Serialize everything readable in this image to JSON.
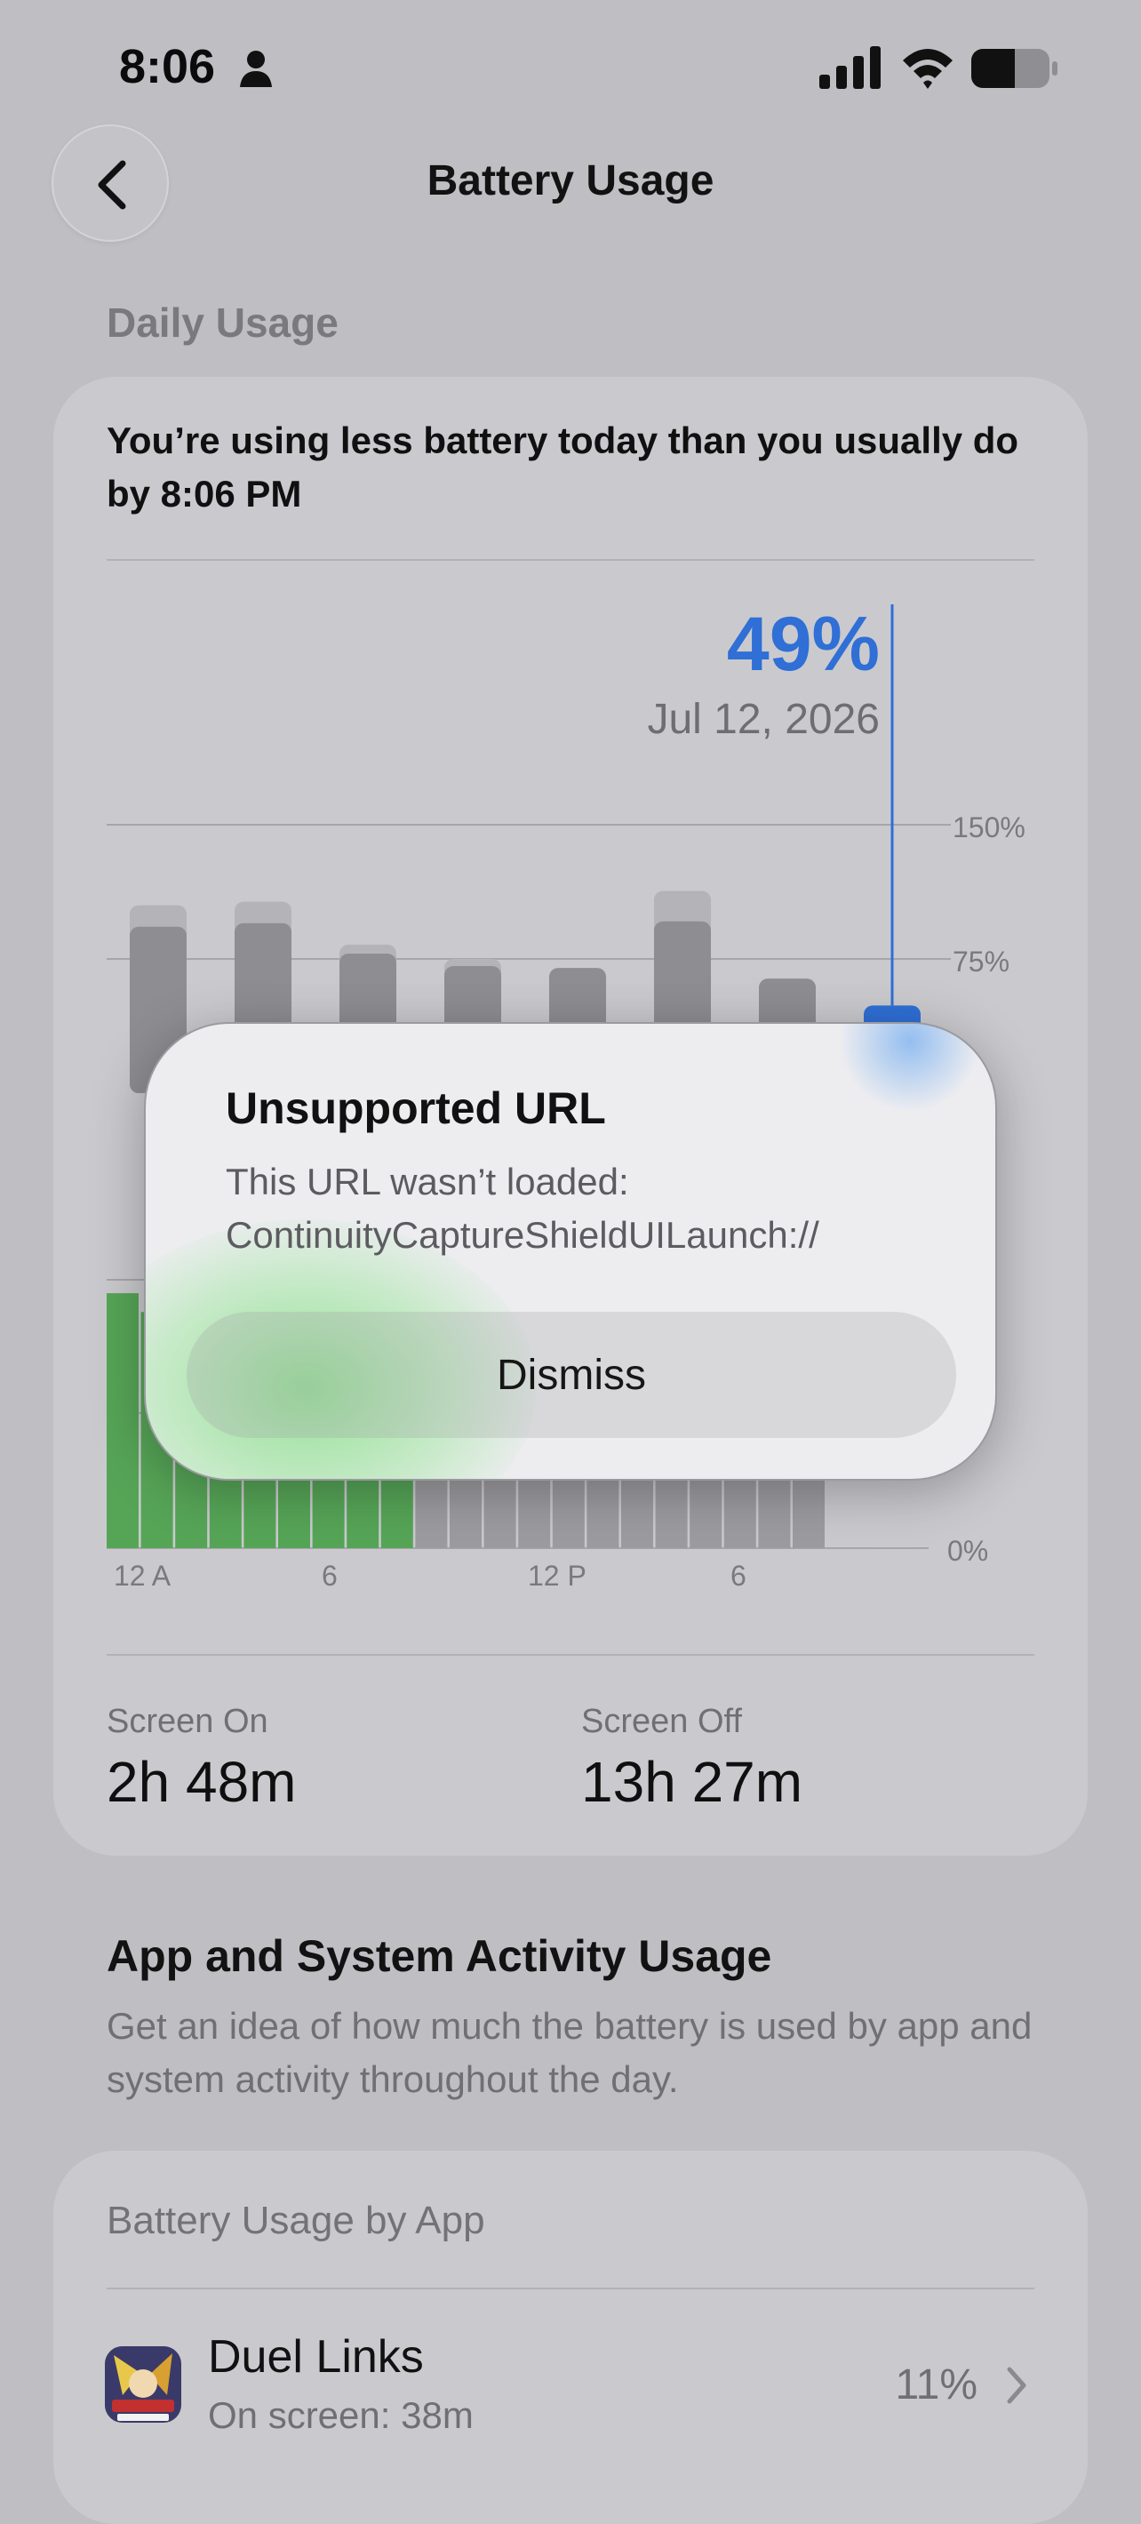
{
  "status_bar": {
    "time": "8:06"
  },
  "nav": {
    "title": "Battery Usage"
  },
  "daily": {
    "section_title": "Daily Usage",
    "headline": "You’re using less battery today than you usually do by 8:06 PM",
    "selected": {
      "percent": "49%",
      "date": "Jul 12, 2026"
    }
  },
  "screen_time": {
    "on_label": "Screen On",
    "on_value": "2h 48m",
    "off_label": "Screen Off",
    "off_value": "13h 27m"
  },
  "app_activity": {
    "title": "App and System Activity Usage",
    "description": "Get an idea of how much the battery is used by app and system activity throughout the day."
  },
  "by_app": {
    "title": "Battery Usage by App",
    "apps": [
      {
        "name": "Duel Links",
        "detail": "On screen: 38m",
        "percent": "11%"
      }
    ]
  },
  "dialog": {
    "title": "Unsupported URL",
    "message_line1": "This URL wasn’t loaded:",
    "message_line2": "ContinuityCaptureShieldUILaunch://",
    "button": "Dismiss"
  },
  "colors": {
    "accent": "#2f6fd6",
    "bar": "#8e8e92",
    "activity": "#56a557"
  },
  "chart_data": [
    {
      "type": "bar",
      "x": [
        1,
        2,
        3,
        4,
        5,
        6,
        7,
        8
      ],
      "ylim": [
        0,
        150
      ],
      "y_ticks": [
        "150%",
        "75%"
      ],
      "series": [
        {
          "values": [
            93,
            95,
            78,
            71,
            70,
            96,
            64,
            49
          ]
        },
        {
          "values": [
            12,
            12,
            5,
            4,
            0,
            17,
            0,
            0
          ]
        }
      ],
      "selected_index": 7,
      "grid": true
    },
    {
      "type": "bar",
      "ylim": [
        0,
        100
      ],
      "y_ticks": [
        "%",
        "%",
        "0%"
      ],
      "x_ticks": [
        "12 A",
        "6",
        "12 P",
        "6"
      ],
      "series": [
        {
          "values": [
            95,
            88,
            85,
            85,
            85,
            85,
            85,
            85,
            85,
            85,
            85,
            85,
            85,
            85,
            85,
            85,
            85,
            85,
            85,
            85,
            85
          ]
        }
      ],
      "active_hours": 9
    }
  ]
}
